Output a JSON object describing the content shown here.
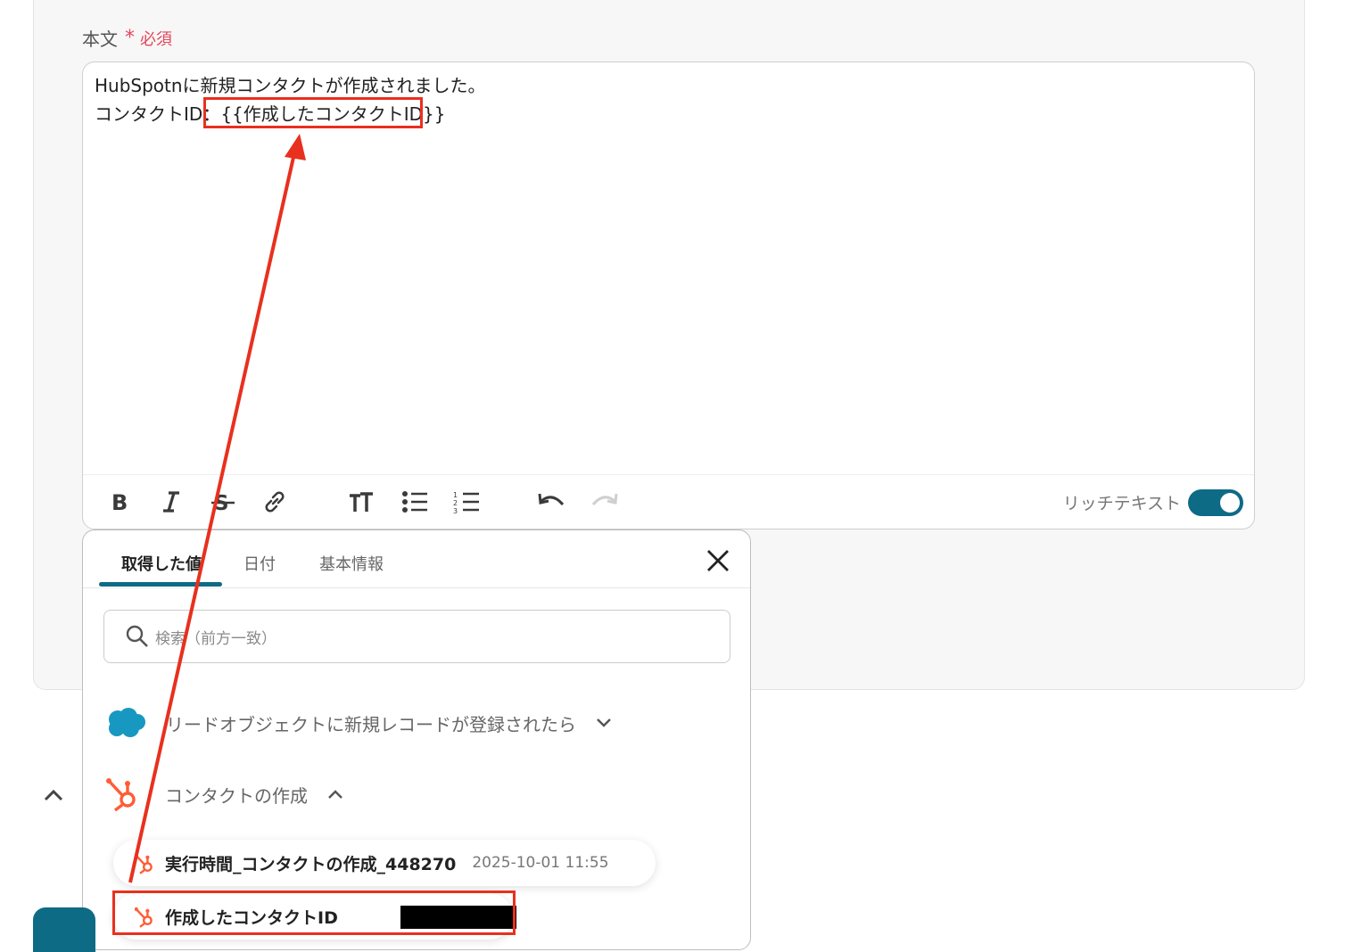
{
  "field": {
    "label": "本文",
    "required_mark": "*",
    "required_text": "必須"
  },
  "editor": {
    "line1": "HubSpotnに新規コンタクトが作成されました。",
    "line2_prefix": "コンタクトID：",
    "line2_token": "{{作成したコンタクトID}}",
    "rich_text_label": "リッチテキスト",
    "rich_text_enabled": true
  },
  "toolbar": {
    "items": [
      "bold-icon",
      "italic-icon",
      "strikethrough-icon",
      "link-icon",
      "text-size-icon",
      "bulleted-list-icon",
      "numbered-list-icon",
      "undo-icon",
      "redo-icon"
    ]
  },
  "popup": {
    "tabs": [
      "取得した値",
      "日付",
      "基本情報"
    ],
    "active_tab": 0,
    "search_placeholder": "検索（前方一致）",
    "sections": [
      {
        "icon": "salesforce-icon",
        "label": "リードオブジェクトに新規レコードが登録されたら",
        "expanded": false
      },
      {
        "icon": "hubspot-icon",
        "label": "コンタクトの作成",
        "expanded": true
      }
    ],
    "items": [
      {
        "icon": "hubspot-icon",
        "name": "実行時間_コンタクトの作成_448270",
        "value": "2025-10-01 11:55"
      },
      {
        "icon": "hubspot-icon",
        "name": "作成したコンタクトID",
        "value": ""
      }
    ]
  },
  "colors": {
    "accent": "#0e6b85",
    "highlight": "#e8301e",
    "required": "#e5475c",
    "hubspot": "#ff5c35",
    "salesforce": "#1798c1"
  }
}
